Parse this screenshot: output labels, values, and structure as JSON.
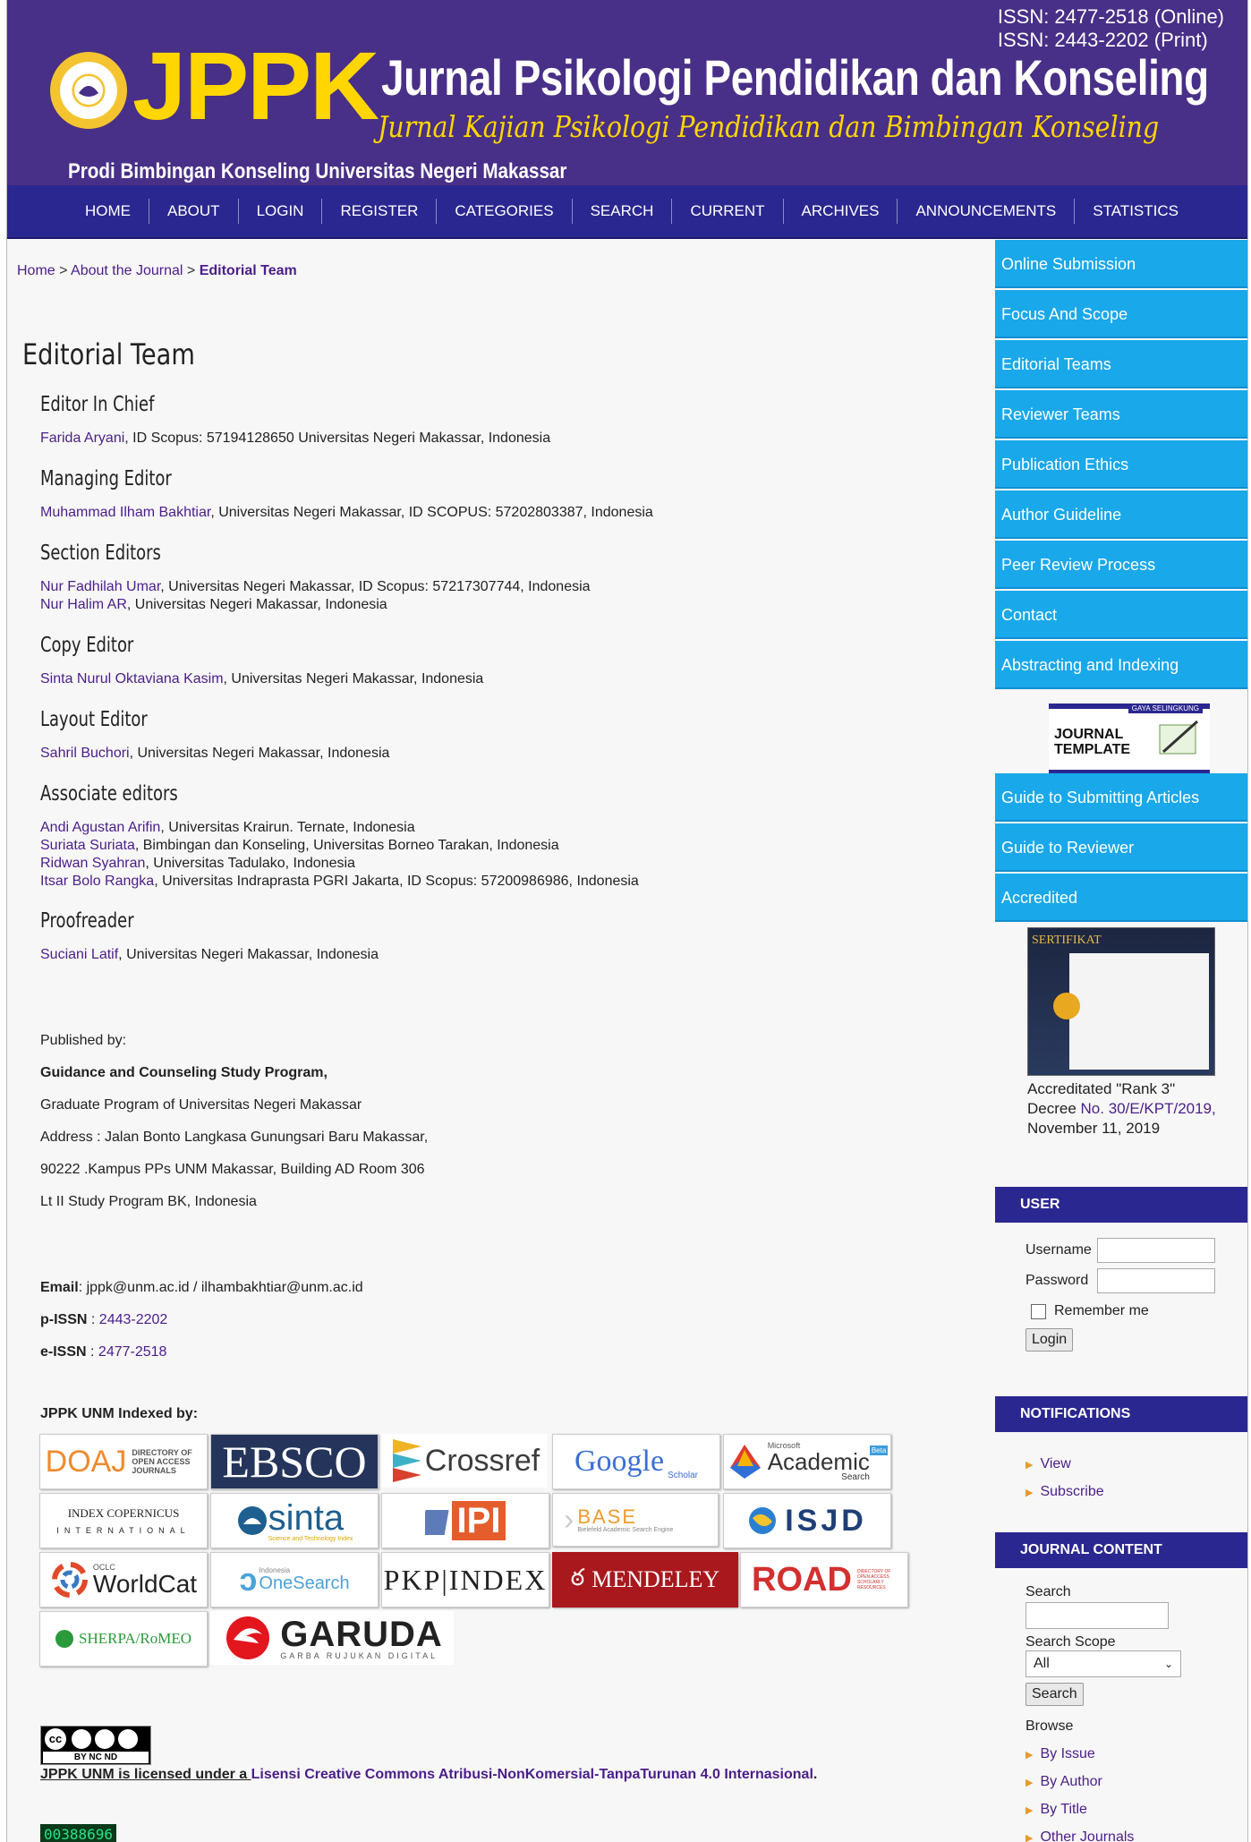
{
  "header": {
    "issn_online": "ISSN: 2477-2518 (Online)",
    "issn_print": "ISSN: 2443-2202 (Print)",
    "logo": "JPPK",
    "title": "Jurnal Psikologi Pendidikan dan Konseling",
    "subtitle": "Jurnal Kajian Psikologi Pendidikan dan Bimbingan Konseling",
    "prodi": "Prodi Bimbingan Konseling Universitas Negeri Makassar"
  },
  "nav": [
    "HOME",
    "ABOUT",
    "LOGIN",
    "REGISTER",
    "CATEGORIES",
    "SEARCH",
    "CURRENT",
    "ARCHIVES",
    "ANNOUNCEMENTS",
    "STATISTICS"
  ],
  "breadcrumb": {
    "home": "Home",
    "sep": " > ",
    "about": "About the Journal",
    "current": "Editorial Team"
  },
  "page_title": "Editorial Team",
  "sections": [
    {
      "title": "Editor In Chief",
      "lines": [
        {
          "name": "Farida Aryani",
          "rest": ", ID Scopus: 57194128650 Universitas Negeri Makassar, Indonesia"
        }
      ]
    },
    {
      "title": "Managing Editor",
      "lines": [
        {
          "name": "Muhammad Ilham Bakhtiar",
          "rest": ", Universitas Negeri Makassar, ID SCOPUS: 57202803387, Indonesia"
        }
      ]
    },
    {
      "title": "Section Editors",
      "lines": [
        {
          "name": "Nur Fadhilah Umar",
          "rest": ", Universitas Negeri Makassar, ID Scopus: 57217307744, Indonesia"
        },
        {
          "name": "Nur Halim AR",
          "rest": ", Universitas Negeri Makassar, Indonesia"
        }
      ]
    },
    {
      "title": "Copy Editor",
      "lines": [
        {
          "name": "Sinta Nurul Oktaviana Kasim",
          "rest": ", Universitas Negeri Makassar, Indonesia"
        }
      ]
    },
    {
      "title": "Layout Editor",
      "lines": [
        {
          "name": "Sahril Buchori",
          "rest": ", Universitas Negeri Makassar, Indonesia"
        }
      ]
    },
    {
      "title": "Associate editors",
      "lines": [
        {
          "name": "Andi Agustan Arifin",
          "rest": ", Universitas Krairun. Ternate, Indonesia"
        },
        {
          "name": "Suriata Suriata",
          "rest": ", Bimbingan dan Konseling, Universitas Borneo Tarakan, Indonesia"
        },
        {
          "name": "Ridwan Syahran",
          "rest": ", Universitas Tadulako, Indonesia"
        },
        {
          "name": "Itsar Bolo Rangka",
          "rest": ", Universitas Indraprasta PGRI Jakarta, ID Scopus: 57200986986, Indonesia"
        }
      ]
    },
    {
      "title": "Proofreader",
      "lines": [
        {
          "name": "Suciani Latif",
          "rest": ", Universitas Negeri Makassar, Indonesia"
        }
      ]
    }
  ],
  "publisher": {
    "label": "Published by:",
    "name": "Guidance and Counseling Study Program,",
    "line1": "Graduate Program of Universitas Negeri Makassar",
    "line2": "Address : Jalan Bonto Langkasa Gunungsari Baru Makassar,",
    "line3": "90222 .Kampus PPs UNM Makassar, Building AD Room 306",
    "line4": "Lt II Study Program BK, Indonesia"
  },
  "contact": {
    "email_label": "Email",
    "email_value": ": jppk@unm.ac.id / ilhambakhtiar@unm.ac.id",
    "pissn_label": "p-ISSN",
    "pissn_sep": " : ",
    "pissn_value": "2443-2202",
    "eissn_label": "e-ISSN",
    "eissn_sep": " : ",
    "eissn_value": "2477-2518"
  },
  "indexed_label": "JPPK UNM Indexed by:",
  "index_logos": {
    "doaj": "DOAJ",
    "doaj_sub": "DIRECTORY OF OPEN ACCESS JOURNALS",
    "ebsco": "EBSCO",
    "crossref": "Crossref",
    "google": "Google",
    "google_sub": "Scholar",
    "academic_ms": "Microsoft",
    "academic": "Academic",
    "academic_sub": "Search",
    "academic_badge": "Beta",
    "copernicus": "INDEX COPERNICUS",
    "copernicus_sub": "INTERNATIONAL",
    "sinta": "sinta",
    "sinta_sub": "Science and Technology Index",
    "ipi": "IPI",
    "base": "BASE",
    "base_sub": "Bielefeld Academic Search Engine",
    "isjd": "ISJD",
    "worldcat_oclc": "OCLC",
    "worldcat": "WorldCat",
    "onesearch_top": "Indonesia",
    "onesearch": "OneSearch",
    "pkp": "PKP|INDEX",
    "mendeley": "MENDELEY",
    "road": "ROAD",
    "road_sub": "DIRECTORY OF OPEN ACCESS SCHOLARLY RESOURCES",
    "sherpa": "SHERPA/RoMEO",
    "garuda": "GARUDA",
    "garuda_sub": "GARBA RUJUKAN DIGITAL"
  },
  "cc_badge": {
    "top": "cc",
    "bottom": "BY  NC  ND"
  },
  "license": {
    "prefix": "JPPK UNM is licensed under a ",
    "link": "Lisensi Creative Commons Atribusi-NonKomersial-TanpaTurunan 4.0 Internasional",
    "suffix": "."
  },
  "counter": "00388696",
  "sidebar": {
    "links_top": [
      "Online Submission",
      "Focus And Scope",
      "Editorial Teams",
      "Reviewer Teams",
      "Publication Ethics",
      "Author Guideline",
      "Peer Review Process",
      "Contact",
      "Abstracting and Indexing"
    ],
    "template_banner": "GAYA SELINGKUNG",
    "template_title": "JOURNAL TEMPLATE",
    "links_mid": [
      "Guide to Submitting Articles",
      "Guide to Reviewer",
      "Accredited"
    ],
    "cert_title": "SERTIFIKAT",
    "accredited_line1": "Accreditated \"Rank 3\"",
    "accredited_decree": "Decree ",
    "accredited_link": "No. 30/E/KPT/2019,",
    "accredited_date": "November 11, 2019",
    "user": {
      "head": "USER",
      "username": "Username",
      "password": "Password",
      "remember": "Remember me",
      "login": "Login"
    },
    "notifications": {
      "head": "NOTIFICATIONS",
      "items": [
        "View",
        "Subscribe"
      ]
    },
    "journal_content": {
      "head": "JOURNAL CONTENT",
      "search": "Search",
      "scope": "Search Scope",
      "scope_value": "All",
      "button": "Search",
      "browse": "Browse",
      "items": [
        "By Issue",
        "By Author",
        "By Title",
        "Other Journals"
      ]
    }
  },
  "colors": {
    "header_bg": "#482f87",
    "nav_bg": "#2b2790",
    "sidebar_btn": "#19a8ea",
    "link": "#4b1e8a",
    "logo_yellow": "#ffd600"
  }
}
